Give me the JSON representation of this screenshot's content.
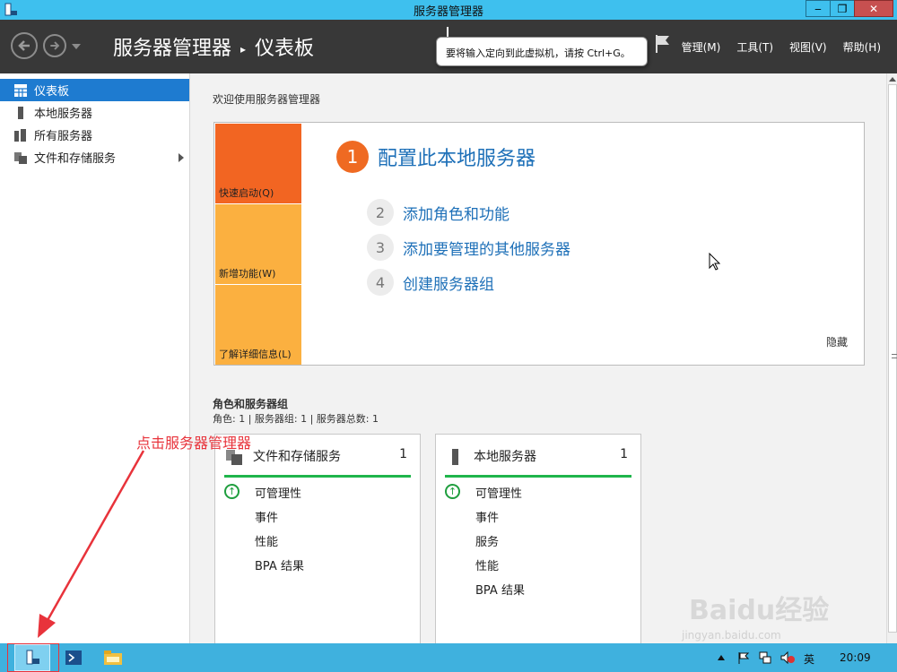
{
  "window": {
    "title": "服务器管理器",
    "minimize": "‒",
    "maximize": "❐",
    "close": "✕"
  },
  "header": {
    "breadcrumb_root": "服务器管理器",
    "breadcrumb_sep": "▸",
    "breadcrumb_current": "仪表板",
    "menu": [
      "管理(M)",
      "工具(T)",
      "视图(V)",
      "帮助(H)"
    ]
  },
  "tooltip": {
    "text": "要将输入定向到此虚拟机，请按 Ctrl+G。"
  },
  "sidebar": {
    "items": [
      {
        "label": "仪表板",
        "icon": "dashboard-icon",
        "active": true
      },
      {
        "label": "本地服务器",
        "icon": "server-icon",
        "active": false
      },
      {
        "label": "所有服务器",
        "icon": "servers-icon",
        "active": false
      },
      {
        "label": "文件和存储服务",
        "icon": "storage-icon",
        "active": false
      }
    ]
  },
  "main": {
    "welcome": "欢迎使用服务器管理器",
    "quickstart": {
      "tiles": [
        {
          "label": "快速启动(Q)",
          "color": "#f26522"
        },
        {
          "label": "新增功能(W)",
          "color": "#fbb040"
        },
        {
          "label": "了解详细信息(L)",
          "color": "#fbb040"
        }
      ],
      "steps": [
        {
          "num": "1",
          "label": "配置此本地服务器"
        },
        {
          "num": "2",
          "label": "添加角色和功能"
        },
        {
          "num": "3",
          "label": "添加要管理的其他服务器"
        },
        {
          "num": "4",
          "label": "创建服务器组"
        }
      ],
      "hide": "隐藏"
    },
    "roles_title": "角色和服务器组",
    "roles_subtitle": "角色: 1 | 服务器组: 1 | 服务器总数: 1",
    "cards": [
      {
        "title": "文件和存储服务",
        "count": "1",
        "rows": [
          "可管理性",
          "事件",
          "性能",
          "BPA 结果"
        ]
      },
      {
        "title": "本地服务器",
        "count": "1",
        "rows": [
          "可管理性",
          "事件",
          "服务",
          "性能",
          "BPA 结果"
        ]
      }
    ]
  },
  "annotation": {
    "text": "点击服务器管理器"
  },
  "taskbar": {
    "buttons": [
      "server-manager-icon",
      "powershell-icon",
      "file-explorer-icon"
    ],
    "ime": "英",
    "time": "20:09"
  },
  "watermark": {
    "text": "Baidu经验",
    "url": "jingyan.baidu.com"
  },
  "colors": {
    "accent": "#1e7bd0",
    "orange": "#f26522",
    "ok_green": "#1fb54b"
  }
}
